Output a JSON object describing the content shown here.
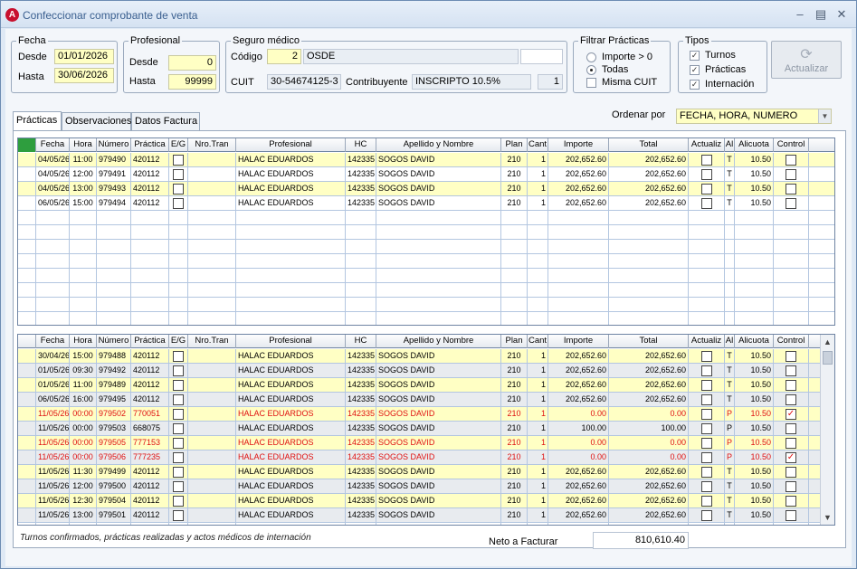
{
  "window": {
    "title": "Confeccionar comprobante de venta",
    "app_icon": "A"
  },
  "fecha": {
    "legend": "Fecha",
    "desde_label": "Desde",
    "desde_value": "01/01/2026",
    "hasta_label": "Hasta",
    "hasta_value": "30/06/2026"
  },
  "profesional": {
    "legend": "Profesional",
    "desde_label": "Desde",
    "desde_value": "0",
    "hasta_label": "Hasta",
    "hasta_value": "99999"
  },
  "seguro": {
    "legend": "Seguro médico",
    "codigo_label": "Código",
    "codigo_value": "2",
    "nombre": "OSDE",
    "cuit_label": "CUIT",
    "cuit_value": "30-54674125-3",
    "contrib_label": "Contribuyente",
    "contrib_value": "INSCRIPTO  10.5%",
    "contrib_num": "1"
  },
  "filtrar": {
    "legend": "Filtrar Prácticas",
    "opt1": "Importe > 0",
    "opt2": "Todas",
    "opt3": "Misma CUIT"
  },
  "tipos": {
    "legend": "Tipos",
    "t1": "Turnos",
    "t2": "Prácticas",
    "t3": "Internación"
  },
  "actualizar_label": "Actualizar",
  "tabs": [
    "Prácticas",
    "Observaciones",
    "Datos Factura"
  ],
  "ordenar": {
    "label": "Ordenar por",
    "value": "FECHA, HORA, NUMERO"
  },
  "columns": [
    "Fecha",
    "Hora",
    "Número",
    "Práctica",
    "E/G",
    "Nro.Tran",
    "Profesional",
    "HC",
    "Apellido y Nombre",
    "Plan",
    "Cant",
    "Importe",
    "Total",
    "Actualiz",
    "Al",
    "Alicuota",
    "Control"
  ],
  "top_rows": [
    {
      "fecha": "04/05/26",
      "hora": "11:00",
      "numero": "979490",
      "practica": "420112",
      "prof": "HALAC EDUARDOS",
      "hc": "142335",
      "nombre": "SOGOS DAVID",
      "plan": "210",
      "cant": "1",
      "importe": "202,652.60",
      "total": "202,652.60",
      "al": "T",
      "alicuota": "10.50",
      "control": false,
      "red": false
    },
    {
      "fecha": "04/05/26",
      "hora": "12:00",
      "numero": "979491",
      "practica": "420112",
      "prof": "HALAC EDUARDOS",
      "hc": "142335",
      "nombre": "SOGOS DAVID",
      "plan": "210",
      "cant": "1",
      "importe": "202,652.60",
      "total": "202,652.60",
      "al": "T",
      "alicuota": "10.50",
      "control": false,
      "red": false
    },
    {
      "fecha": "04/05/26",
      "hora": "13:00",
      "numero": "979493",
      "practica": "420112",
      "prof": "HALAC EDUARDOS",
      "hc": "142335",
      "nombre": "SOGOS DAVID",
      "plan": "210",
      "cant": "1",
      "importe": "202,652.60",
      "total": "202,652.60",
      "al": "T",
      "alicuota": "10.50",
      "control": false,
      "red": false
    },
    {
      "fecha": "06/05/26",
      "hora": "15:00",
      "numero": "979494",
      "practica": "420112",
      "prof": "HALAC EDUARDOS",
      "hc": "142335",
      "nombre": "SOGOS DAVID",
      "plan": "210",
      "cant": "1",
      "importe": "202,652.60",
      "total": "202,652.60",
      "al": "T",
      "alicuota": "10.50",
      "control": false,
      "red": false
    }
  ],
  "bottom_rows": [
    {
      "fecha": "30/04/26",
      "hora": "15:00",
      "numero": "979488",
      "practica": "420112",
      "prof": "HALAC EDUARDOS",
      "hc": "142335",
      "nombre": "SOGOS DAVID",
      "plan": "210",
      "cant": "1",
      "importe": "202,652.60",
      "total": "202,652.60",
      "al": "T",
      "alicuota": "10.50",
      "control": false,
      "red": false
    },
    {
      "fecha": "01/05/26",
      "hora": "09:30",
      "numero": "979492",
      "practica": "420112",
      "prof": "HALAC EDUARDOS",
      "hc": "142335",
      "nombre": "SOGOS DAVID",
      "plan": "210",
      "cant": "1",
      "importe": "202,652.60",
      "total": "202,652.60",
      "al": "T",
      "alicuota": "10.50",
      "control": false,
      "red": false
    },
    {
      "fecha": "01/05/26",
      "hora": "11:00",
      "numero": "979489",
      "practica": "420112",
      "prof": "HALAC EDUARDOS",
      "hc": "142335",
      "nombre": "SOGOS DAVID",
      "plan": "210",
      "cant": "1",
      "importe": "202,652.60",
      "total": "202,652.60",
      "al": "T",
      "alicuota": "10.50",
      "control": false,
      "red": false
    },
    {
      "fecha": "06/05/26",
      "hora": "16:00",
      "numero": "979495",
      "practica": "420112",
      "prof": "HALAC EDUARDOS",
      "hc": "142335",
      "nombre": "SOGOS DAVID",
      "plan": "210",
      "cant": "1",
      "importe": "202,652.60",
      "total": "202,652.60",
      "al": "T",
      "alicuota": "10.50",
      "control": false,
      "red": false
    },
    {
      "fecha": "11/05/26",
      "hora": "00:00",
      "numero": "979502",
      "practica": "770051",
      "prof": "HALAC EDUARDOS",
      "hc": "142335",
      "nombre": "SOGOS DAVID",
      "plan": "210",
      "cant": "1",
      "importe": "0.00",
      "total": "0.00",
      "al": "P",
      "alicuota": "10.50",
      "control": true,
      "red": true
    },
    {
      "fecha": "11/05/26",
      "hora": "00:00",
      "numero": "979503",
      "practica": "668075",
      "prof": "HALAC EDUARDOS",
      "hc": "142335",
      "nombre": "SOGOS DAVID",
      "plan": "210",
      "cant": "1",
      "importe": "100.00",
      "total": "100.00",
      "al": "P",
      "alicuota": "10.50",
      "control": false,
      "red": false
    },
    {
      "fecha": "11/05/26",
      "hora": "00:00",
      "numero": "979505",
      "practica": "777153",
      "prof": "HALAC EDUARDOS",
      "hc": "142335",
      "nombre": "SOGOS DAVID",
      "plan": "210",
      "cant": "1",
      "importe": "0.00",
      "total": "0.00",
      "al": "P",
      "alicuota": "10.50",
      "control": false,
      "red": true
    },
    {
      "fecha": "11/05/26",
      "hora": "00:00",
      "numero": "979506",
      "practica": "777235",
      "prof": "HALAC EDUARDOS",
      "hc": "142335",
      "nombre": "SOGOS DAVID",
      "plan": "210",
      "cant": "1",
      "importe": "0.00",
      "total": "0.00",
      "al": "P",
      "alicuota": "10.50",
      "control": true,
      "red": true
    },
    {
      "fecha": "11/05/26",
      "hora": "11:30",
      "numero": "979499",
      "practica": "420112",
      "prof": "HALAC EDUARDOS",
      "hc": "142335",
      "nombre": "SOGOS DAVID",
      "plan": "210",
      "cant": "1",
      "importe": "202,652.60",
      "total": "202,652.60",
      "al": "T",
      "alicuota": "10.50",
      "control": false,
      "red": false
    },
    {
      "fecha": "11/05/26",
      "hora": "12:00",
      "numero": "979500",
      "practica": "420112",
      "prof": "HALAC EDUARDOS",
      "hc": "142335",
      "nombre": "SOGOS DAVID",
      "plan": "210",
      "cant": "1",
      "importe": "202,652.60",
      "total": "202,652.60",
      "al": "T",
      "alicuota": "10.50",
      "control": false,
      "red": false
    },
    {
      "fecha": "11/05/26",
      "hora": "12:30",
      "numero": "979504",
      "practica": "420112",
      "prof": "HALAC EDUARDOS",
      "hc": "142335",
      "nombre": "SOGOS DAVID",
      "plan": "210",
      "cant": "1",
      "importe": "202,652.60",
      "total": "202,652.60",
      "al": "T",
      "alicuota": "10.50",
      "control": false,
      "red": false
    },
    {
      "fecha": "11/05/26",
      "hora": "13:00",
      "numero": "979501",
      "practica": "420112",
      "prof": "HALAC EDUARDOS",
      "hc": "142335",
      "nombre": "SOGOS DAVID",
      "plan": "210",
      "cant": "1",
      "importe": "202,652.60",
      "total": "202,652.60",
      "al": "T",
      "alicuota": "10.50",
      "control": false,
      "red": false
    }
  ],
  "status_text": "Turnos confirmados, prácticas realizadas y actos médicos de internación",
  "neto": {
    "label": "Neto a Facturar",
    "value": "810,610.40"
  },
  "colors": {
    "row_yellow": "#ffffc4",
    "row_white": "#ffffff",
    "row_gray": "#e8ebef",
    "red_text": "#e01010",
    "indicator_green": "#2e9e3e"
  }
}
